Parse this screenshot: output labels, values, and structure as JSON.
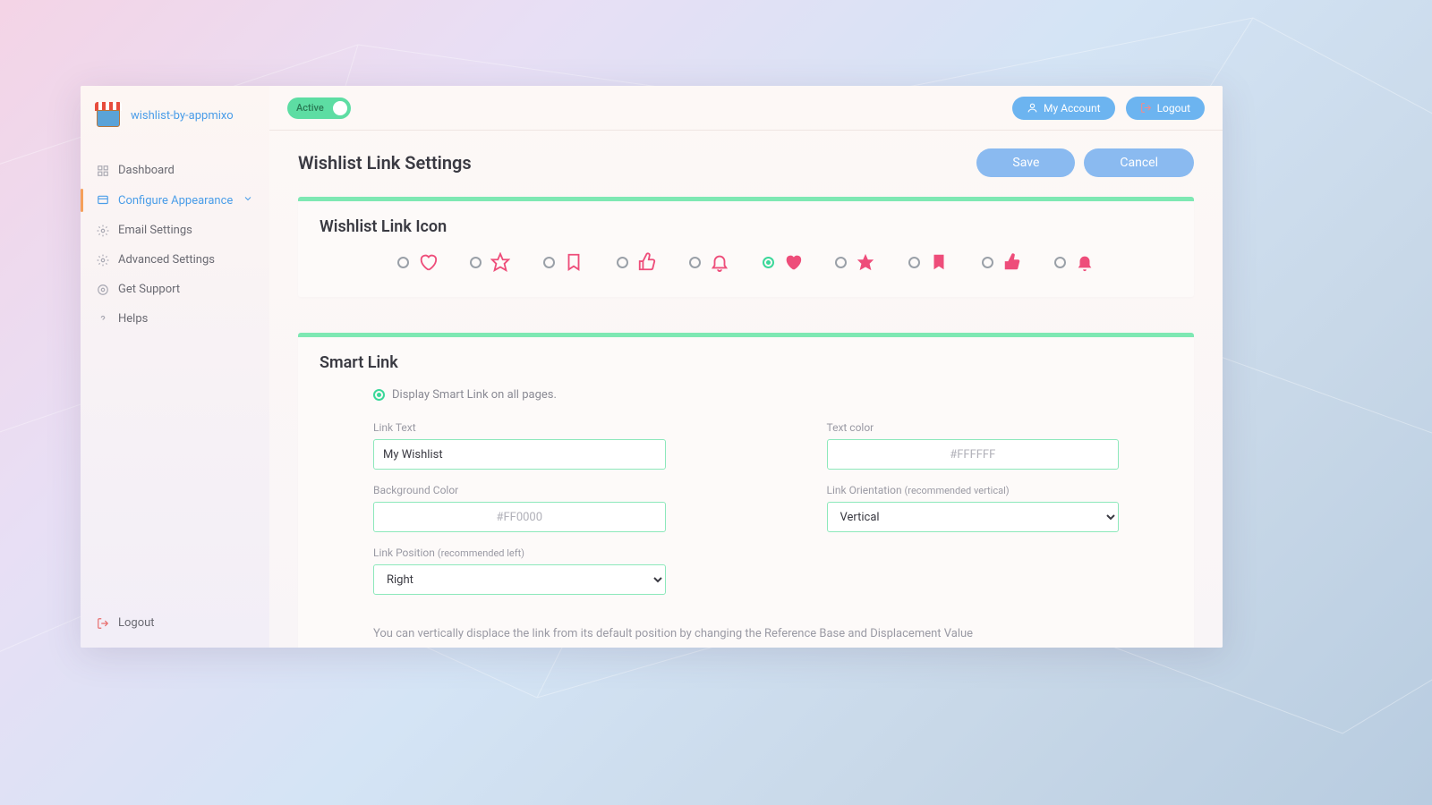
{
  "brand": {
    "name": "wishlist-by-appmixo"
  },
  "sidebar": {
    "items": [
      {
        "label": "Dashboard",
        "icon": "grid-icon"
      },
      {
        "label": "Configure Appearance",
        "icon": "palette-icon",
        "active": true,
        "expandable": true
      },
      {
        "label": "Email Settings",
        "icon": "gear-icon"
      },
      {
        "label": "Advanced Settings",
        "icon": "gear-icon"
      },
      {
        "label": "Get Support",
        "icon": "support-icon"
      },
      {
        "label": "Helps",
        "icon": "question-icon"
      }
    ],
    "footer": {
      "logout_label": "Logout"
    }
  },
  "topbar": {
    "toggle_label": "Active",
    "my_account_label": "My Account",
    "logout_label": "Logout"
  },
  "page": {
    "title": "Wishlist Link Settings",
    "save_label": "Save",
    "cancel_label": "Cancel"
  },
  "wishlist_icon_card": {
    "title": "Wishlist Link Icon",
    "options": [
      {
        "name": "heart-outline",
        "selected": false
      },
      {
        "name": "star-outline",
        "selected": false
      },
      {
        "name": "bookmark-outline",
        "selected": false
      },
      {
        "name": "thumbsup-outline",
        "selected": false
      },
      {
        "name": "bell-outline",
        "selected": false
      },
      {
        "name": "heart-filled",
        "selected": true
      },
      {
        "name": "star-filled",
        "selected": false
      },
      {
        "name": "bookmark-filled",
        "selected": false
      },
      {
        "name": "thumbsup-filled",
        "selected": false
      },
      {
        "name": "bell-filled",
        "selected": false
      }
    ]
  },
  "smart_link_card": {
    "title": "Smart Link",
    "display_label": "Display Smart Link on all pages.",
    "fields": {
      "link_text": {
        "label": "Link Text",
        "value": "My Wishlist"
      },
      "text_color": {
        "label": "Text color",
        "placeholder": "#FFFFFF"
      },
      "bg_color": {
        "label": "Background Color",
        "placeholder": "#FF0000"
      },
      "orientation": {
        "label": "Link Orientation ",
        "hint": "(recommended vertical)",
        "value": "Vertical"
      },
      "position": {
        "label": "Link Position ",
        "hint": "(recommended left)",
        "value": "Right"
      }
    },
    "help_text": "You can vertically displace the link from its default position by changing the Reference Base and Displacement Value"
  },
  "colors": {
    "accent_blue": "#6cb4f0",
    "accent_green": "#5ddda3",
    "icon_pink": "#ee4d7a"
  }
}
